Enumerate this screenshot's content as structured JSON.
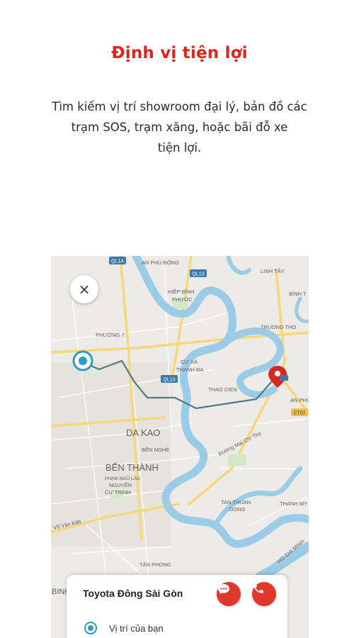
{
  "header": {
    "title": "Định vị tiện lợi",
    "description_lines": [
      "Tìm kiếm vị trí showroom đại lý, bản đồ các",
      "trạm SOS, trạm xăng, hoặc bãi đỗ xe",
      "tiện lợi."
    ]
  },
  "map": {
    "close_icon": "×",
    "labels": {
      "an_phu_dong": "AN PHÚ ĐÔNG",
      "ql1a": "QL1A",
      "ql13_top": "QL13",
      "linh_tay": "LINH TÂY",
      "binh_t": "BÌNH T",
      "hiep_binh_1": "HIỆP BÌNH",
      "hiep_binh_2": "PHƯỚC",
      "phuong_7": "PHƯỜNG 7",
      "truong_tho": "TRUONG THO",
      "cu_xa_1": "CƯ XÁ",
      "cu_xa_2": "THANH ĐA",
      "ql13_mid": "QL13",
      "thao_dien": "THAO DIEN",
      "an_phu": "AN PHU",
      "ct01": "CT01",
      "da_kao": "DA KAO",
      "ben_nghe": "BẾN NGHÉ",
      "duong_mai_chi_tho": "Đường Mai Chí Thọ",
      "ben_thanh": "BẾN THÀNH",
      "pham_ngu_lao": "PHẠM NGŨ LÃO",
      "cu_trinh_1": "NGUYỄN",
      "cu_trinh_2": "CƯ TRINH",
      "vo_van_kiet": "Võ Văn Kiệt",
      "tan_thuan_1": "TAN THUAN",
      "tan_thuan_2": "DONG",
      "thanh_my": "THANH MY",
      "ho_chi_minh": "HO CHI MINH",
      "tan_phong": "TÂN PHONG",
      "binh": "BINH"
    }
  },
  "card": {
    "dealer_name": "Toyota Đông Sài Gòn",
    "chat_icon": "chat-bubble-icon",
    "phone_icon": "phone-icon",
    "your_location_label": "Vị trí của bạn"
  },
  "colors": {
    "accent": "#e2231a",
    "button_red": "#e0392b",
    "water": "#9bcbe6",
    "route": "#4f7d87",
    "location_blue": "#2e9cc4"
  }
}
